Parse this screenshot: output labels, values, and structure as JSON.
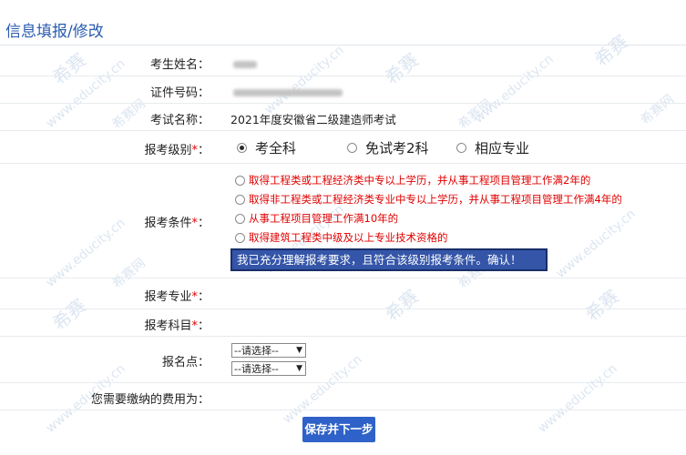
{
  "page_title": "信息填报/修改",
  "fields": {
    "name_label": "考生姓名：",
    "id_label": "证件号码：",
    "exam_label": "考试名称：",
    "exam_value": "2021年度安徽省二级建造师考试",
    "level_label": "报考级别",
    "cond_label": "报考条件",
    "major_label": "报考专业",
    "subject_label": "报考科目",
    "site_label": "报名点：",
    "fee_label": "您需要缴纳的费用为：",
    "required_mark": "*",
    "colon": "："
  },
  "levels": [
    {
      "label": "考全科",
      "checked": true
    },
    {
      "label": "免试考2科",
      "checked": false
    },
    {
      "label": "相应专业",
      "checked": false
    }
  ],
  "conditions": [
    "取得工程类或工程经济类中专以上学历，并从事工程项目管理工作满2年的",
    "取得非工程类或工程经济类专业中专以上学历，并从事工程项目管理工作满4年的",
    "从事工程项目管理工作满10年的",
    "取得建筑工程类中级及以上专业技术资格的"
  ],
  "confirm_text": "我已充分理解报考要求，且符合该级别报考条件。确认！",
  "selects": [
    {
      "value": "--请选择--"
    },
    {
      "value": "--请选择--"
    }
  ],
  "submit_label": "保存并下一步",
  "watermark": {
    "brand": "希赛",
    "site": "www.educity.cn",
    "brand_net": "希赛网"
  },
  "colors": {
    "title": "#2a5bb0",
    "required": "#e00000",
    "confirm_bg": "#3455a8",
    "button_bg": "#2f62c8"
  }
}
